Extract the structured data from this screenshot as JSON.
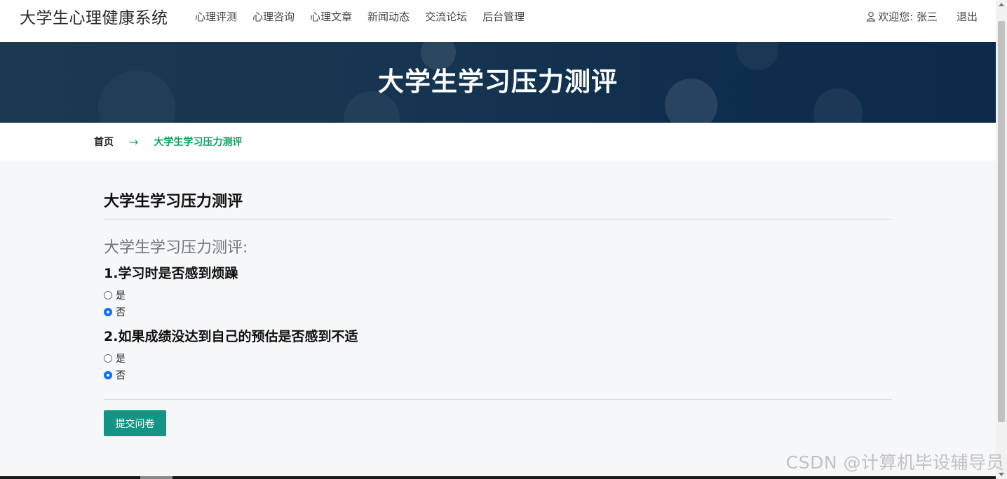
{
  "navbar": {
    "brand": "大学生心理健康系统",
    "links": [
      "心理评测",
      "心理咨询",
      "心理文章",
      "新闻动态",
      "交流论坛",
      "后台管理"
    ],
    "welcome": "欢迎您: 张三",
    "logout": "退出"
  },
  "banner": {
    "title": "大学生学习压力测评"
  },
  "breadcrumb": {
    "home": "首页",
    "arrow": "→",
    "current": "大学生学习压力测评"
  },
  "survey": {
    "title": "大学生学习压力测评",
    "name": "大学生学习压力测评:",
    "questions": [
      {
        "text": "1.学习时是否感到烦躁",
        "options": [
          "是",
          "否"
        ],
        "selected": "否"
      },
      {
        "text": "2.如果成绩没达到自己的预估是否感到不适",
        "options": [
          "是",
          "否"
        ],
        "selected": "否"
      }
    ],
    "submit_label": "提交问卷"
  },
  "watermark": "CSDN @计算机毕设辅导员",
  "colors": {
    "accent": "#149484",
    "breadcrumb_active": "#12a05f",
    "radio_checked": "#0d6efd",
    "banner": "#163550"
  }
}
